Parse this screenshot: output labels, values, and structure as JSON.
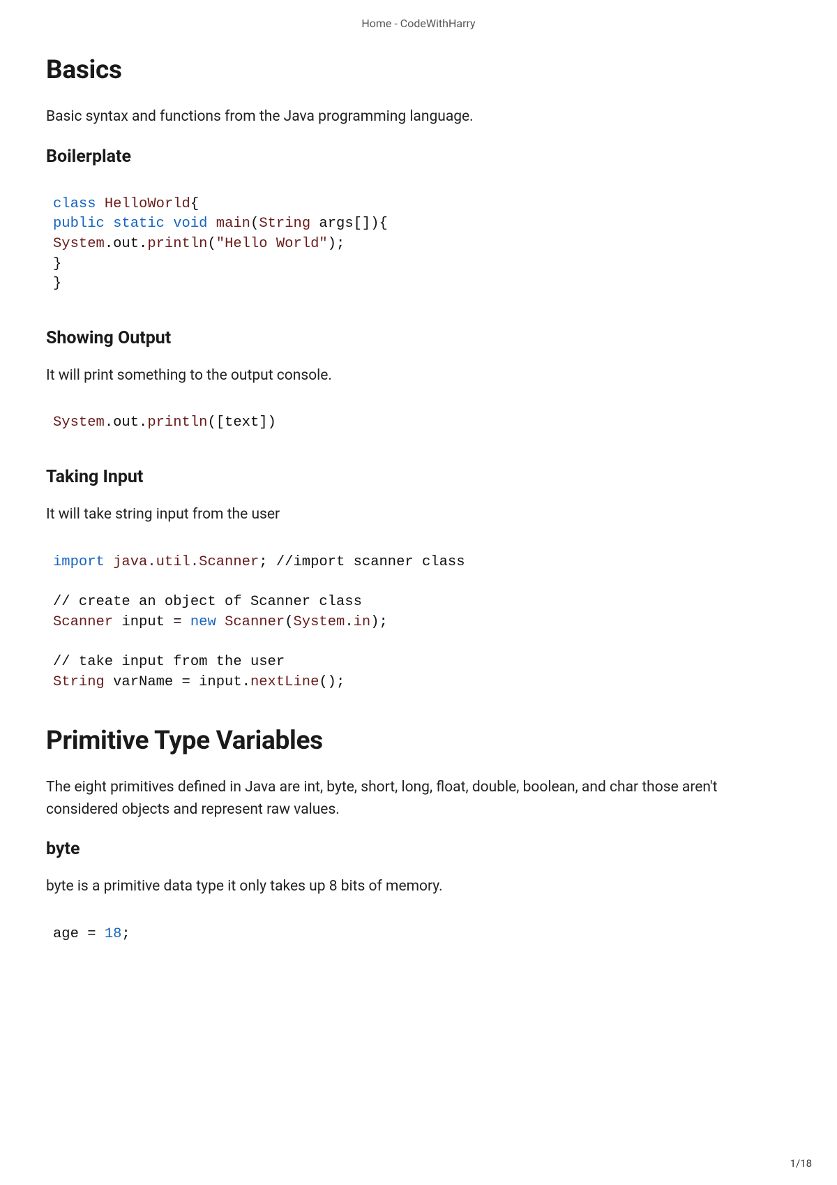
{
  "header": {
    "title": "Home - CodeWithHarry"
  },
  "footer": {
    "page": "1/18"
  },
  "sections": {
    "basics": {
      "h1": "Basics",
      "intro": "Basic syntax and functions from the Java programming language.",
      "boilerplate_h2": "Boilerplate",
      "showing_h2": "Showing Output",
      "showing_p": "It will print something to the output console.",
      "taking_h2": "Taking Input",
      "taking_p": "It will take string input from the user"
    },
    "primitive": {
      "h1": "Primitive Type Variables",
      "intro": "The eight primitives defined in Java are int, byte, short, long, float, double, boolean, and char those aren't considered objects and represent raw values.",
      "byte_h2": "byte",
      "byte_p": "byte is a primitive data type it only takes up 8 bits of memory."
    }
  },
  "code": {
    "boilerplate": {
      "l1a": "class",
      "l1b": " ",
      "l1c": "HelloWorld",
      "l1d": "{",
      "l2a": "public",
      "l2b": " ",
      "l2c": "static",
      "l2d": " ",
      "l2e": "void",
      "l2f": " ",
      "l2g": "main",
      "l2h": "(",
      "l2i": "String",
      "l2j": " args[]){",
      "l3a": "System",
      "l3b": ".out.",
      "l3c": "println",
      "l3d": "(",
      "l3e": "\"Hello World\"",
      "l3f": ");",
      "l4": "}",
      "l5": "}"
    },
    "showing": {
      "a": "System",
      "b": ".out.",
      "c": "println",
      "d": "([text])"
    },
    "taking": {
      "l1a": "import",
      "l1b": " ",
      "l1c": "java.util.Scanner",
      "l1d": "; //import scanner class",
      "l3": "// create an object of Scanner class",
      "l4a": "Scanner",
      "l4b": " input = ",
      "l4c": "new",
      "l4d": " ",
      "l4e": "Scanner",
      "l4f": "(",
      "l4g": "System",
      "l4h": ".",
      "l4i": "in",
      "l4j": ");",
      "l6": "// take input from the user",
      "l7a": "String",
      "l7b": " varName = input.",
      "l7c": "nextLine",
      "l7d": "();"
    },
    "byte": {
      "a": "age = ",
      "b": "18",
      "c": ";"
    }
  }
}
